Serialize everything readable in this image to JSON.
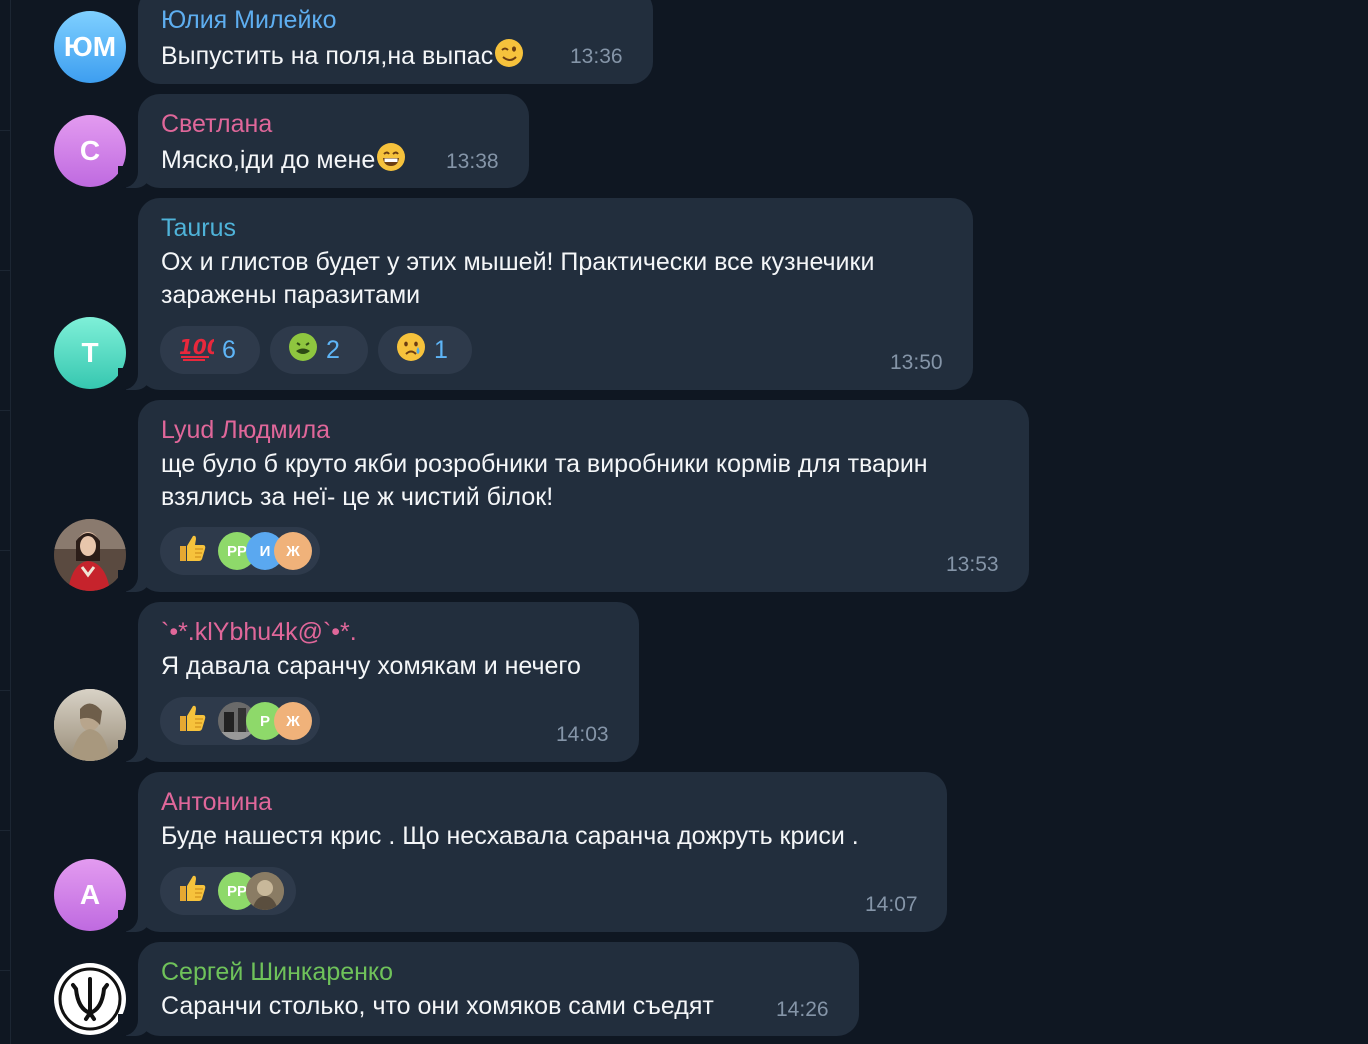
{
  "messages": [
    {
      "author": "Юлия Милейко",
      "initials": "ЮМ",
      "text": "Выпустить на поля,на выпас",
      "time": "13:36",
      "emoji": "wink-emoji"
    },
    {
      "author": "Светлана",
      "initials": "С",
      "text": "Мяско,іди до мене",
      "time": "13:38",
      "emoji": "grin-emoji"
    },
    {
      "author": "Taurus",
      "initials": "T",
      "text_lines": [
        "Ох и глистов будет у этих мышей! Практически все кузнечики",
        "заражены паразитами"
      ],
      "time": "13:50",
      "reactions": [
        {
          "icon": "hundred-points-emoji",
          "count": "6"
        },
        {
          "icon": "nauseated-face-emoji",
          "count": "2"
        },
        {
          "icon": "crying-face-emoji",
          "count": "1"
        }
      ]
    },
    {
      "author": "Lyud Людмила",
      "text_lines": [
        "ще було б круто якби розробники та виробники кормів для тварин",
        "взялись за неї- це ж чистий білок!"
      ],
      "time": "13:53",
      "reaction_icon": "thumbs-up-emoji",
      "reactors": [
        "РР",
        "И",
        "Ж"
      ]
    },
    {
      "author": "`•*.klYbhu4k@`•*.",
      "text": "Я давала саранчу хомякам и нечего",
      "time": "14:03",
      "reaction_icon": "thumbs-up-emoji",
      "reactors": [
        "",
        "Р",
        "Ж"
      ]
    },
    {
      "author": "Антонина",
      "initials": "А",
      "text": "Буде нашестя крис . Що несхавала саранча дожруть криси .",
      "time": "14:07",
      "reaction_icon": "thumbs-up-emoji",
      "reactors": [
        "РР",
        ""
      ]
    },
    {
      "author": "Сергей Шинкаренко",
      "text": "Саранчи столько, что они хомяков сами съедят",
      "time": "14:26"
    }
  ],
  "colors": {
    "background": "#0f1722",
    "bubble": "#222e3d",
    "reaction_pill": "#2e3a4b",
    "reaction_count": "#5eb5f7",
    "time": "#8595a8",
    "name_blue": "#5eaef0",
    "name_pink": "#e0679a",
    "name_cyan": "#4fb3d9",
    "name_green": "#6fc25a"
  }
}
